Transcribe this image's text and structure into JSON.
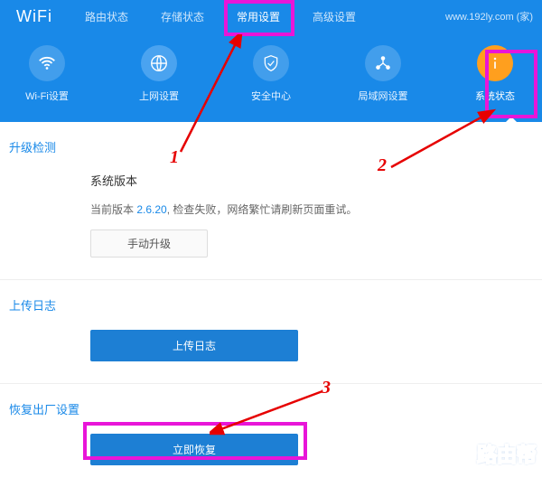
{
  "logo": "WiFi",
  "topnav": {
    "t0": "路由状态",
    "t1": "存储状态",
    "t2": "常用设置",
    "t3": "高级设置"
  },
  "siteinfo": "www.192ly.com (家)",
  "icons": {
    "wifi": "Wi-Fi设置",
    "net": "上网设置",
    "sec": "安全中心",
    "lan": "局域网设置",
    "sys": "系统状态"
  },
  "sec1": {
    "title": "升级检测",
    "systitle": "系统版本",
    "pre": "当前版本 ",
    "ver": "2.6.20",
    "post": ", 检查失败，网络繁忙请刷新页面重试。",
    "btn": "手动升级"
  },
  "sec2": {
    "title": "上传日志",
    "btn": "上传日志"
  },
  "sec3": {
    "title": "恢复出厂设置",
    "btn": "立即恢复"
  },
  "annot": {
    "n1": "1",
    "n2": "2",
    "n3": "3"
  },
  "watermark": "路由帮"
}
